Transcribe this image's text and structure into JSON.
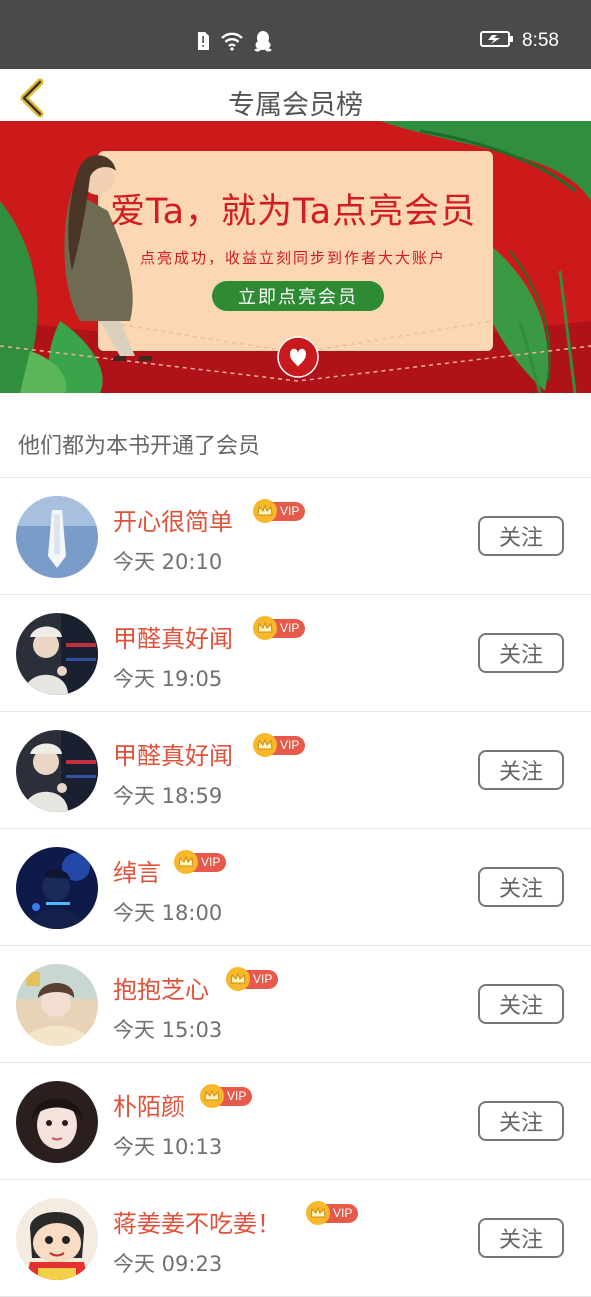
{
  "status": {
    "time": "8:58"
  },
  "header": {
    "title": "专属会员榜"
  },
  "banner": {
    "headline": "爱Ta，就为Ta点亮会员",
    "subtitle": "点亮成功，收益立刻同步到作者大大账户",
    "button": "立即点亮会员"
  },
  "section": {
    "heading": "他们都为本书开通了会员"
  },
  "members": [
    {
      "name": "开心很简单",
      "badge": "VIP",
      "time": "今天 20:10",
      "follow": "关注"
    },
    {
      "name": "甲醛真好闻",
      "badge": "VIP",
      "time": "今天 19:05",
      "follow": "关注"
    },
    {
      "name": "甲醛真好闻",
      "badge": "VIP",
      "time": "今天 18:59",
      "follow": "关注"
    },
    {
      "name": "绰言",
      "badge": "VIP",
      "time": "今天 18:00",
      "follow": "关注"
    },
    {
      "name": "抱抱芝心",
      "badge": "VIP",
      "time": "今天 15:03",
      "follow": "关注"
    },
    {
      "name": "朴陌颜",
      "badge": "VIP",
      "time": "今天 10:13",
      "follow": "关注"
    },
    {
      "name": "蒋姜姜不吃姜！",
      "badge": "VIP",
      "time": "今天 09:23",
      "follow": "关注"
    }
  ],
  "colors": {
    "accent": "#e0513a",
    "banner": "#cc1a1a",
    "vip": "#e55a4a",
    "crown": "#f7b92b"
  }
}
